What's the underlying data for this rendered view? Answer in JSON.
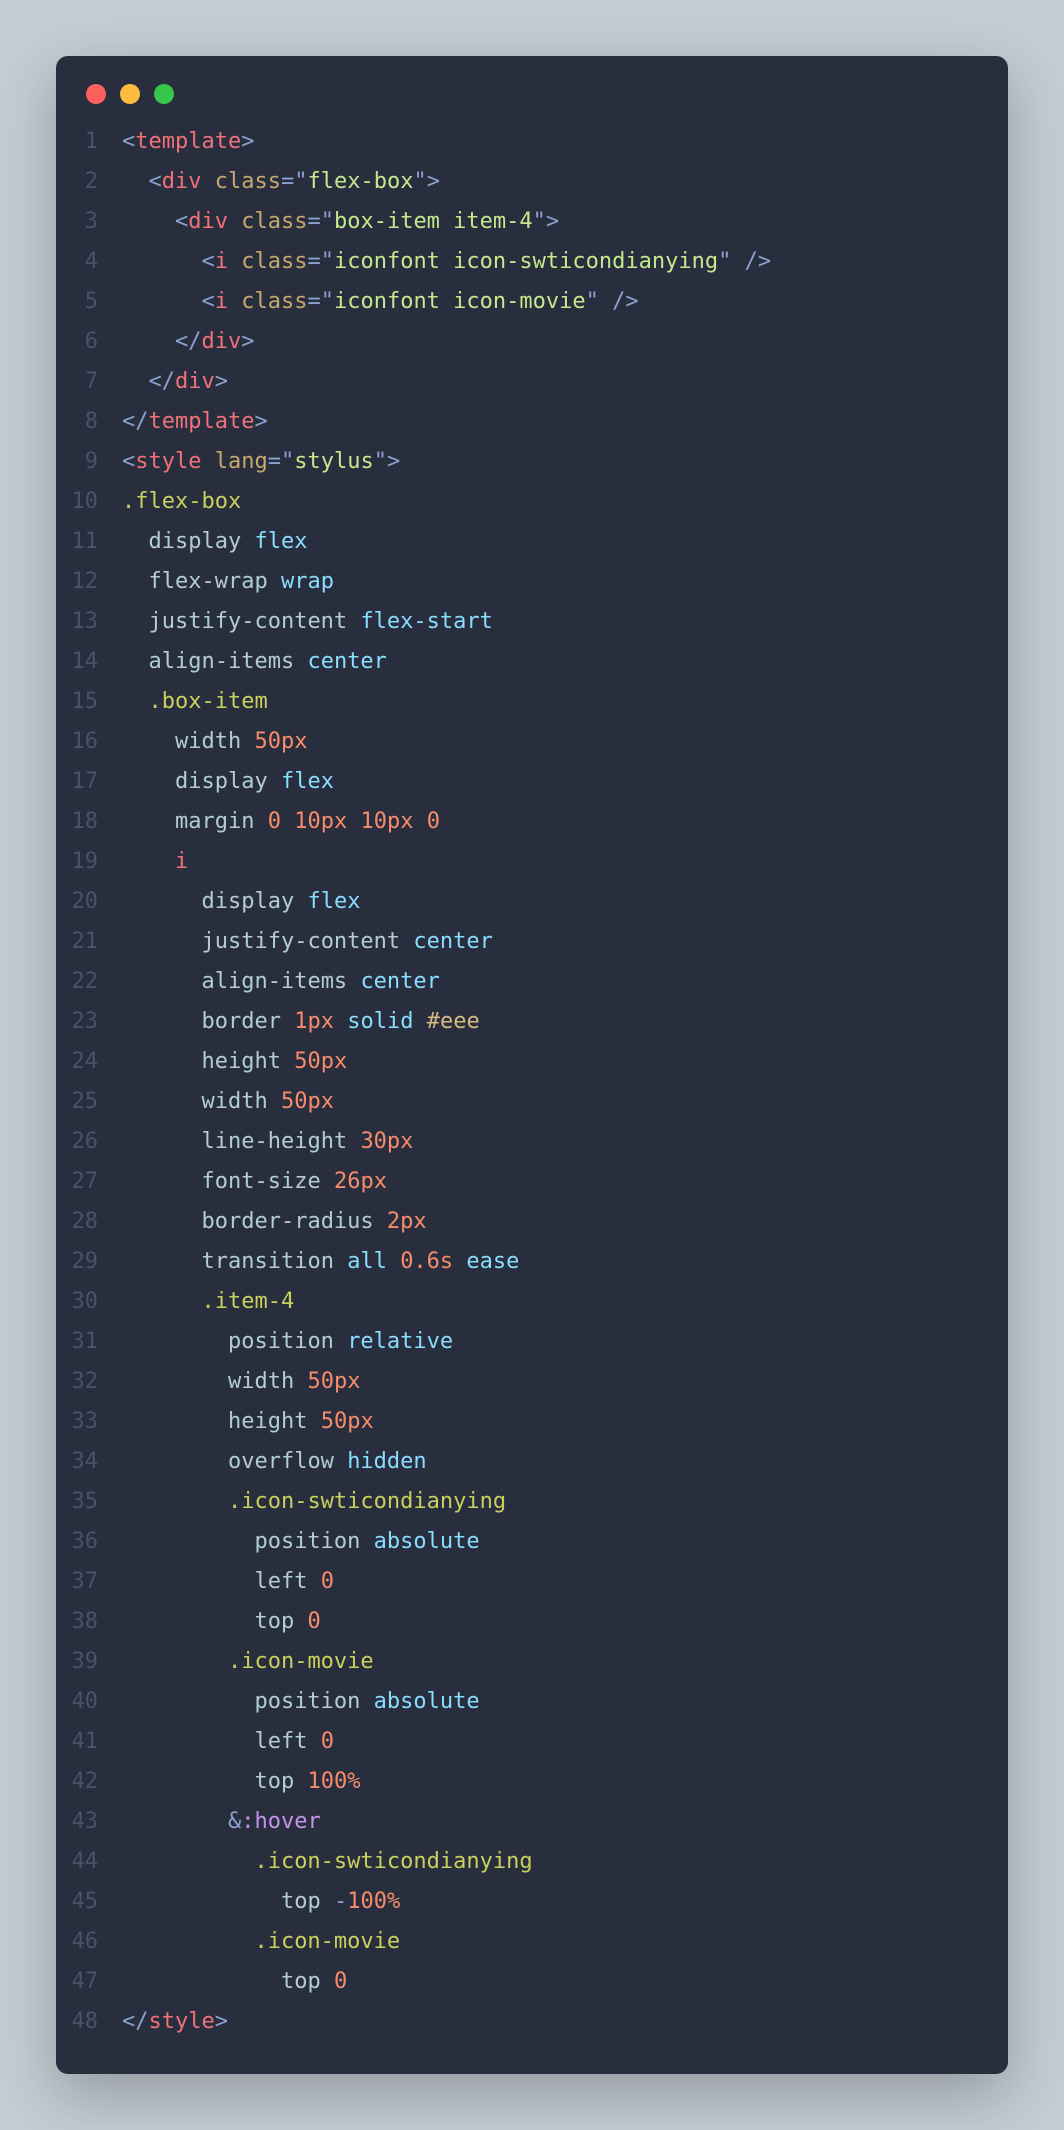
{
  "gutter": [
    "1",
    "2",
    "3",
    "4",
    "5",
    "6",
    "7",
    "8",
    "9",
    "10",
    "11",
    "12",
    "13",
    "14",
    "15",
    "16",
    "17",
    "18",
    "19",
    "20",
    "21",
    "22",
    "23",
    "24",
    "25",
    "26",
    "27",
    "28",
    "29",
    "30",
    "31",
    "32",
    "33",
    "34",
    "35",
    "36",
    "37",
    "38",
    "39",
    "40",
    "41",
    "42",
    "43",
    "44",
    "45",
    "46",
    "47",
    "48"
  ],
  "code": {
    "l1": {
      "tag": "template"
    },
    "l2": {
      "tag": "div",
      "attr": "class",
      "val": "flex-box"
    },
    "l3": {
      "tag": "div",
      "attr": "class",
      "val": "box-item item-4"
    },
    "l4": {
      "tag": "i",
      "attr": "class",
      "val": "iconfont icon-swticondianying"
    },
    "l5": {
      "tag": "i",
      "attr": "class",
      "val": "iconfont icon-movie"
    },
    "l6": {
      "tag": "div"
    },
    "l7": {
      "tag": "div"
    },
    "l8": {
      "tag": "template"
    },
    "l9": {
      "tag": "style",
      "attr": "lang",
      "val": "stylus"
    },
    "l10": {
      "sel": ".flex-box"
    },
    "l11": {
      "prop": "display",
      "val": "flex"
    },
    "l12": {
      "prop": "flex-wrap",
      "val": "wrap"
    },
    "l13": {
      "prop": "justify-content",
      "val": "flex-start"
    },
    "l14": {
      "prop": "align-items",
      "val": "center"
    },
    "l15": {
      "sel": ".box-item"
    },
    "l16": {
      "prop": "width",
      "val": "50px"
    },
    "l17": {
      "prop": "display",
      "val": "flex"
    },
    "l18": {
      "prop": "margin",
      "v1": "0",
      "v2": "10px",
      "v3": "10px",
      "v4": "0"
    },
    "l19": {
      "sel": "i"
    },
    "l20": {
      "prop": "display",
      "val": "flex"
    },
    "l21": {
      "prop": "justify-content",
      "val": "center"
    },
    "l22": {
      "prop": "align-items",
      "val": "center"
    },
    "l23": {
      "prop": "border",
      "v1": "1px",
      "v2": "solid",
      "v3": "#eee"
    },
    "l24": {
      "prop": "height",
      "val": "50px"
    },
    "l25": {
      "prop": "width",
      "val": "50px"
    },
    "l26": {
      "prop": "line-height",
      "val": "30px"
    },
    "l27": {
      "prop": "font-size",
      "val": "26px"
    },
    "l28": {
      "prop": "border-radius",
      "val": "2px"
    },
    "l29": {
      "prop": "transition",
      "v1": "all",
      "v2": "0.6s",
      "v3": "ease"
    },
    "l30": {
      "sel": ".item-4"
    },
    "l31": {
      "prop": "position",
      "val": "relative"
    },
    "l32": {
      "prop": "width",
      "val": "50px"
    },
    "l33": {
      "prop": "height",
      "val": "50px"
    },
    "l34": {
      "prop": "overflow",
      "val": "hidden"
    },
    "l35": {
      "sel": ".icon-swticondianying"
    },
    "l36": {
      "prop": "position",
      "val": "absolute"
    },
    "l37": {
      "prop": "left",
      "val": "0"
    },
    "l38": {
      "prop": "top",
      "val": "0"
    },
    "l39": {
      "sel": ".icon-movie"
    },
    "l40": {
      "prop": "position",
      "val": "absolute"
    },
    "l41": {
      "prop": "left",
      "val": "0"
    },
    "l42": {
      "prop": "top",
      "val": "100%"
    },
    "l43": {
      "amp": "&",
      "pseudo": ":hover"
    },
    "l44": {
      "sel": ".icon-swticondianying"
    },
    "l45": {
      "prop": "top",
      "minus": "-",
      "val": "100%"
    },
    "l46": {
      "sel": ".icon-movie"
    },
    "l47": {
      "prop": "top",
      "val": "0"
    },
    "l48": {
      "tag": "style"
    }
  }
}
